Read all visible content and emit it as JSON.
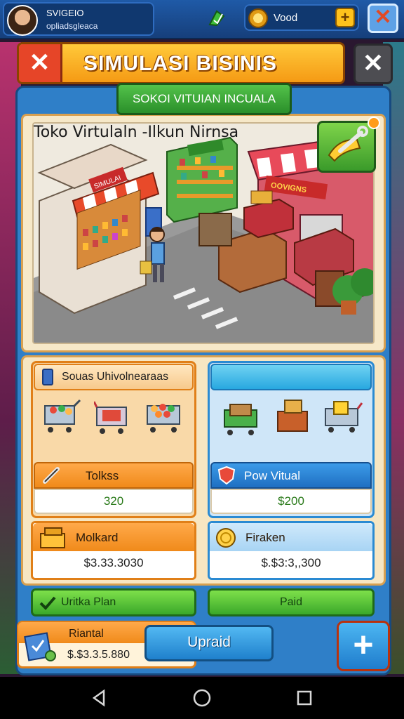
{
  "status_bar": {
    "player_name": "SVIGEIO",
    "player_subtitle": "opliadsgleaca",
    "currency_label": "Vood",
    "add_currency": "+",
    "close": "✕"
  },
  "title": {
    "badge": "✕",
    "text": "SIMULASI  BISINIS",
    "close": "✕"
  },
  "subtitle_tab": "SOKOI VITUIAN INCUALA",
  "scene": {
    "caption": "Toko Virtulaln -Ilkun Nirnsa",
    "shop_sign_left": "SIMULAI",
    "shop_sign_right": "OOVIGNS",
    "stand_sign": "SIMULAI"
  },
  "left_card": {
    "header": "Souas Uhivolnearaas",
    "stat_label": "Tolkss",
    "stat_value": "320",
    "money_label": "Molkard",
    "money_value": "$3.33.3030"
  },
  "right_card": {
    "header": "",
    "stat_label": "Pow Vitual",
    "stat_value": "$200",
    "money_label": "Firaken",
    "money_value": "$.$3:3,,300"
  },
  "buttons": {
    "left_green": "Uritka Plan",
    "right_green": "Paid",
    "upgrade": "Upraid",
    "plus": "+"
  },
  "bottom": {
    "label": "Riantal",
    "value": "$.$3.3.5.880"
  },
  "nav": {
    "back": "◁",
    "home": "○",
    "recents": "□"
  }
}
